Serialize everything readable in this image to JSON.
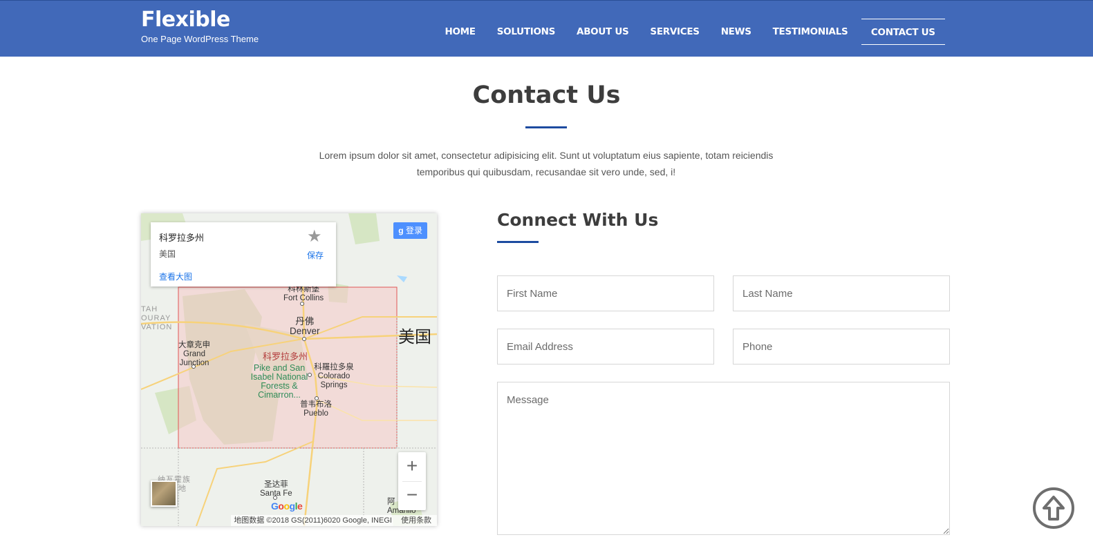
{
  "brand": {
    "title": "Flexible",
    "subtitle": "One Page WordPress Theme"
  },
  "nav": {
    "items": [
      "HOME",
      "SOLUTIONS",
      "ABOUT US",
      "SERVICES",
      "NEWS",
      "TESTIMONIALS",
      "CONTACT US"
    ],
    "active": "CONTACT US"
  },
  "section": {
    "title": "Contact Us",
    "description": "Lorem ipsum dolor sit amet, consectetur adipisicing elit. Sunt ut voluptatum eius sapiente, totam reiciendis temporibus qui quibusdam, recusandae sit vero unde, sed, i!"
  },
  "map": {
    "info_card": {
      "name": "科罗拉多州",
      "country": "美国",
      "save": "保存",
      "view_larger": "查看大图"
    },
    "signin": "登录",
    "zoom_in": "+",
    "zoom_out": "−",
    "labels": {
      "fort_collins_cn": "科林斯堡",
      "fort_collins": "Fort Collins",
      "denver_cn": "丹佛",
      "denver": "Denver",
      "grand_junction_cn": "大章克申",
      "grand_junction": "Grand Junction",
      "state": "科罗拉多州",
      "colorado_springs_cn": "科羅拉多泉",
      "colorado_springs": "Colorado Springs",
      "park": "Pike and San Isabel National Forests & Cimarron...",
      "pueblo_cn": "普韦布洛",
      "pueblo": "Pueblo",
      "santa_fe_cn": "圣达菲",
      "santa_fe": "Santa Fe",
      "usa": "美国",
      "utah_res": "TAH OURAY VATION",
      "navajo": "纳瓦霍族 保留地",
      "amarillo_cn": "阿",
      "amarillo": "Amarillo"
    },
    "google": "Google",
    "attribution": "地图数据 ©2018 GS(2011)6020 Google, INEGI",
    "terms": "使用条款"
  },
  "form": {
    "title": "Connect With Us",
    "first_name_placeholder": "First Name",
    "last_name_placeholder": "Last Name",
    "email_placeholder": "Email Address",
    "phone_placeholder": "Phone",
    "message_placeholder": "Message"
  },
  "colors": {
    "header_bg": "#4169b9",
    "accent": "#1d4ba0",
    "map_highlight": "#f5c9c9"
  },
  "icons": {
    "back_to_top": "arrow-up-circle-icon",
    "star": "star-icon"
  }
}
